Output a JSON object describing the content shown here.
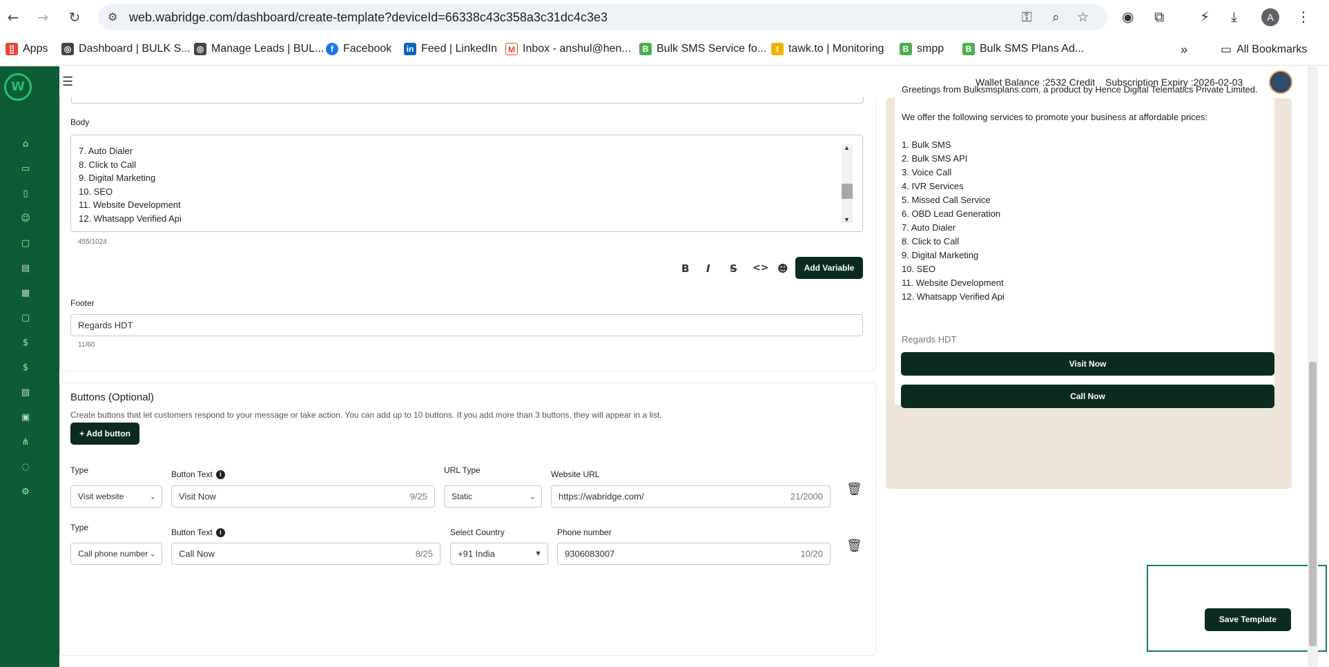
{
  "browser": {
    "url": "web.wabridge.com/dashboard/create-template?deviceId=66338c43c358a3c31dc4c3e3",
    "avatar_letter": "A",
    "bookmarks": [
      {
        "label": "Apps",
        "icon": "apps-grid-icon",
        "color": "#ea4335"
      },
      {
        "label": "Dashboard | BULK S...",
        "icon": "globe-icon",
        "color": "#444444"
      },
      {
        "label": "Manage Leads | BUL...",
        "icon": "globe-icon",
        "color": "#444444"
      },
      {
        "label": "Facebook",
        "icon": "facebook-icon",
        "color": "#1877f2"
      },
      {
        "label": "Feed | LinkedIn",
        "icon": "linkedin-icon",
        "color": "#0a66c2"
      },
      {
        "label": "Inbox - anshul@hen...",
        "icon": "gmail-icon",
        "color": "#ea4335"
      },
      {
        "label": "Bulk SMS Service fo...",
        "icon": "bulksms-icon",
        "color": "#4caf50"
      },
      {
        "label": "tawk.to | Monitoring",
        "icon": "tawk-icon",
        "color": "#f0b400"
      },
      {
        "label": "smpp",
        "icon": "bulksms-icon",
        "color": "#4caf50"
      },
      {
        "label": "Bulk SMS Plans Ad...",
        "icon": "bulksms-icon",
        "color": "#4caf50"
      }
    ],
    "more_label": "»",
    "all_bookmarks": "All Bookmarks"
  },
  "header": {
    "wallet": "Wallet Balance :2532 Credit",
    "expiry": "Subscription Expiry :2026-02-03"
  },
  "body_section": {
    "label": "Body",
    "lines": [
      "7. Auto Dialer",
      "8. Click to Call",
      "9. Digital Marketing",
      "10. SEO",
      "11. Website Development",
      "12. Whatsapp Verified Api"
    ],
    "count": "455/1024",
    "add_variable": "Add Variable"
  },
  "footer_section": {
    "label": "Footer",
    "value": "Regards HDT",
    "count": "11/60"
  },
  "buttons_section": {
    "title": "Buttons (Optional)",
    "description": "Create buttons that let customers respond to your message or take action. You can add up to 10 buttons. If you add more than 3 buttons, they will appear in a list.",
    "add_button": "+ Add button",
    "row1": {
      "type_label": "Type",
      "type_value": "Visit website",
      "text_label": "Button Text",
      "text_value": "Visit Now",
      "text_count": "9/25",
      "url_type_label": "URL Type",
      "url_type_value": "Static",
      "url_label": "Website URL",
      "url_value": "https://wabridge.com/",
      "url_count": "21/2000"
    },
    "row2": {
      "type_label": "Type",
      "type_value": "Call phone number",
      "text_label": "Button Text",
      "text_value": "Call Now",
      "text_count": "8/25",
      "country_label": "Select Country",
      "country_value": "+91 India",
      "phone_label": "Phone number",
      "phone_value": "9306083007",
      "phone_count": "10/20"
    }
  },
  "preview": {
    "text": "Greetings from Bulksmsplans.com, a product by Hence Digital Telematics Private Limited.\n\nWe offer the following services to promote your business at affordable prices:\n\n1. Bulk SMS\n2. Bulk SMS API\n3. Voice Call\n4. IVR Services\n5. Missed Call Service\n6. OBD Lead Generation\n7. Auto Dialer\n8. Click to Call\n9. Digital Marketing\n10. SEO\n11. Website Development\n12. Whatsapp Verified Api",
    "footer": "Regards HDT",
    "button1": "Visit Now",
    "button2": "Call Now"
  },
  "save_button": "Save Template",
  "colors": {
    "sidebar": "#0e5c36",
    "dark_button": "#0a2b1d",
    "highlight": "#12804b"
  }
}
